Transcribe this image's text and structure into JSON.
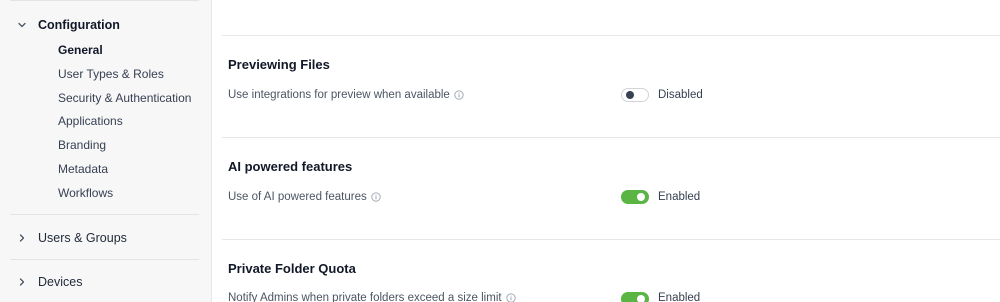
{
  "sidebar": {
    "configuration": {
      "label": "Configuration",
      "items": [
        "General",
        "User Types & Roles",
        "Security & Authentication",
        "Applications",
        "Branding",
        "Metadata",
        "Workflows"
      ]
    },
    "users_groups": "Users & Groups",
    "devices": "Devices"
  },
  "sections": [
    {
      "title": "Previewing Files",
      "label": "Use integrations for preview when available",
      "enabled": false,
      "state": "Disabled"
    },
    {
      "title": "AI powered features",
      "label": "Use of AI powered features",
      "enabled": true,
      "state": "Enabled"
    },
    {
      "title": "Private Folder Quota",
      "label": "Notify Admins when private folders exceed a size limit",
      "enabled": true,
      "state": "Enabled"
    }
  ],
  "colors": {
    "toggle_on": "#5ab545",
    "toggle_off_knob": "#374151"
  },
  "icons": {
    "expanded": "chevron-down-icon",
    "collapsed": "chevron-right-icon",
    "info": "info-icon"
  }
}
